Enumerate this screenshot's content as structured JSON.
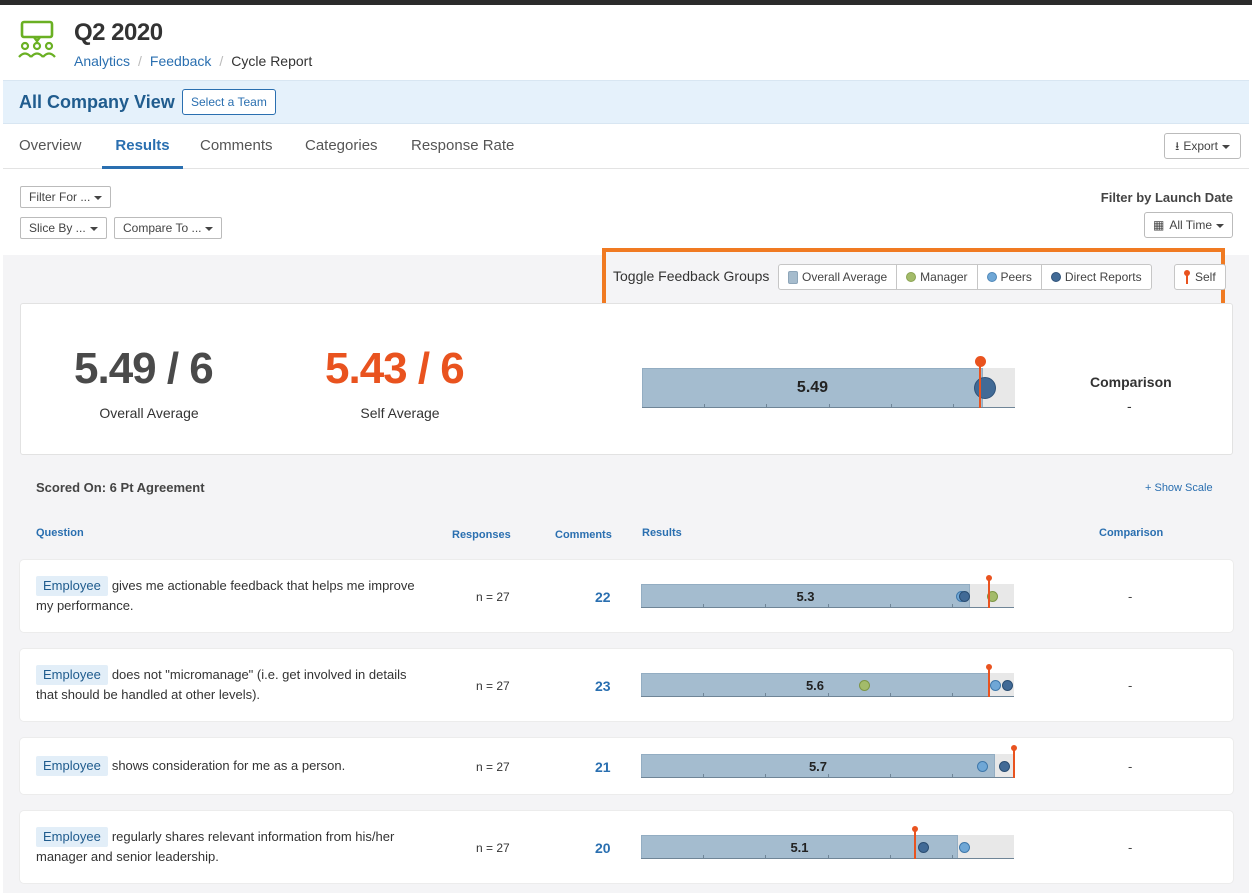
{
  "header": {
    "title": "Q2 2020",
    "breadcrumb": [
      "Analytics",
      "Feedback",
      "Cycle Report"
    ]
  },
  "company_bar": {
    "title": "All Company View",
    "select_team_label": "Select a Team"
  },
  "tabs": [
    {
      "label": "Overview",
      "active": false
    },
    {
      "label": "Results",
      "active": true
    },
    {
      "label": "Comments",
      "active": false
    },
    {
      "label": "Categories",
      "active": false
    },
    {
      "label": "Response Rate",
      "active": false
    }
  ],
  "export_label": "Export",
  "filters": {
    "filter_for": "Filter For ...",
    "slice_by": "Slice By ...",
    "compare_to": "Compare To ...",
    "launch_date_label": "Filter by Launch Date",
    "launch_date_value": "All Time"
  },
  "toggle": {
    "label": "Toggle Feedback Groups",
    "groups": [
      "Overall Average",
      "Manager",
      "Peers",
      "Direct Reports"
    ],
    "self_label": "Self"
  },
  "colors": {
    "accent": "#2a6fb0",
    "self": "#e9531f",
    "highlight_border": "#f07a22",
    "overall_bar": "#a4bccf",
    "manager": "#a3bb6a",
    "peers": "#6fa7d6",
    "direct_reports": "#416a96"
  },
  "summary": {
    "overall_score": "5.49 / 6",
    "overall_label": "Overall Average",
    "self_score": "5.43 / 6",
    "self_label": "Self Average",
    "bar_value_label": "5.49",
    "overall_value": 5.49,
    "self_value": 5.43,
    "direct_reports_value": 5.52,
    "comparison_label": "Comparison",
    "comparison_value": "-"
  },
  "scale": {
    "scored_on": "Scored On: 6 Pt Agreement",
    "show_scale": "+ Show Scale",
    "max": 6
  },
  "columns": {
    "question": "Question",
    "responses": "Responses",
    "comments": "Comments",
    "results": "Results",
    "comparison": "Comparison"
  },
  "questions": [
    {
      "tag": "Employee",
      "text": "gives me actionable feedback that helps me improve my performance.",
      "responses": "n = 27",
      "comments": "22",
      "result_label": "5.3",
      "overall": 5.3,
      "peers": 5.15,
      "direct_reports": 5.2,
      "manager": 5.65,
      "self": 5.6,
      "comparison": "-"
    },
    {
      "tag": "Employee",
      "text": "does not \"micromanage\" (i.e. get involved in details that should be handled at other levels).",
      "responses": "n = 27",
      "comments": "23",
      "result_label": "5.6",
      "overall": 5.6,
      "manager": 3.6,
      "peers": 5.7,
      "direct_reports": 5.9,
      "self": 5.6,
      "comparison": "-"
    },
    {
      "tag": "Employee",
      "text": "shows consideration for me as a person.",
      "responses": "n = 27",
      "comments": "21",
      "result_label": "5.7",
      "overall": 5.7,
      "peers": 5.5,
      "direct_reports": 5.85,
      "self": 6.0,
      "comparison": "-"
    },
    {
      "tag": "Employee",
      "text": "regularly shares relevant information from his/her manager and senior leadership.",
      "responses": "n = 27",
      "comments": "20",
      "result_label": "5.1",
      "overall": 5.1,
      "direct_reports": 4.55,
      "peers": 5.2,
      "self": 4.4,
      "comparison": "-"
    }
  ]
}
